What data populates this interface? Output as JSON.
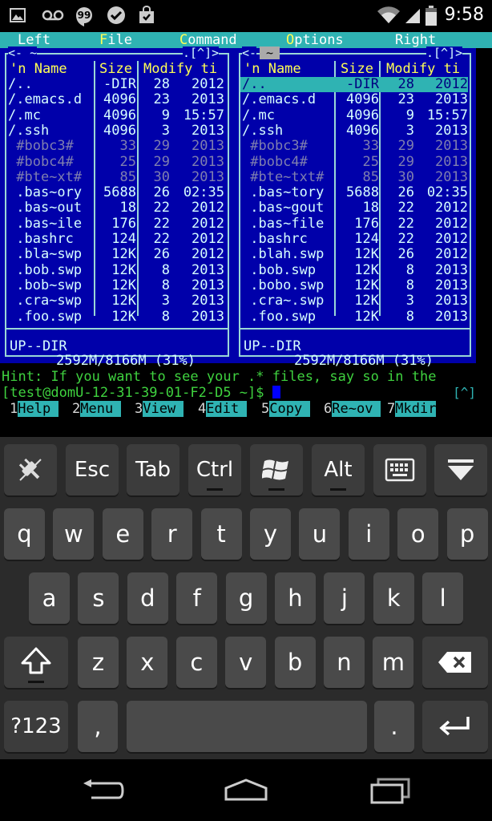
{
  "status_bar": {
    "time": "9:58"
  },
  "terminal": {
    "menu": [
      {
        "hot": "",
        "label": "Left"
      },
      {
        "hot": "F",
        "label": "ile"
      },
      {
        "hot": "C",
        "label": "ommand"
      },
      {
        "hot": "O",
        "label": "ptions"
      },
      {
        "hot": "",
        "label": "Right"
      }
    ],
    "left_panel": {
      "top_left": "<- ~",
      "top_right": ".[^]>",
      "header_name": "'n Name",
      "header_size": "Size",
      "header_modify": "Modify ti",
      "rows": [
        {
          "name": "/..",
          "size": "-DIR",
          "d": "28",
          "t": "2012",
          "dim": false
        },
        {
          "name": "/.emacs.d",
          "size": "4096",
          "d": "23",
          "t": "2013",
          "dim": false
        },
        {
          "name": "/.mc",
          "size": "4096",
          "d": "9",
          "t": "15:57",
          "dim": false
        },
        {
          "name": "/.ssh",
          "size": "4096",
          "d": "3",
          "t": "2013",
          "dim": false
        },
        {
          "name": " #bobc3#",
          "size": "33",
          "d": "29",
          "t": "2013",
          "dim": true
        },
        {
          "name": " #bobc4#",
          "size": "25",
          "d": "29",
          "t": "2013",
          "dim": true
        },
        {
          "name": " #bte~xt#",
          "size": "85",
          "d": "30",
          "t": "2013",
          "dim": true
        },
        {
          "name": " .bas~ory",
          "size": "5688",
          "d": "26",
          "t": "02:35",
          "dim": false
        },
        {
          "name": " .bas~out",
          "size": "18",
          "d": "22",
          "t": "2012",
          "dim": false
        },
        {
          "name": " .bas~ile",
          "size": "176",
          "d": "22",
          "t": "2012",
          "dim": false
        },
        {
          "name": " .bashrc",
          "size": "124",
          "d": "22",
          "t": "2012",
          "dim": false
        },
        {
          "name": " .bla~swp",
          "size": "12K",
          "d": "26",
          "t": "2012",
          "dim": false
        },
        {
          "name": " .bob.swp",
          "size": "12K",
          "d": "8",
          "t": "2013",
          "dim": false
        },
        {
          "name": " .bob~swp",
          "size": "12K",
          "d": "8",
          "t": "2013",
          "dim": false
        },
        {
          "name": " .cra~swp",
          "size": "12K",
          "d": "3",
          "t": "2013",
          "dim": false
        },
        {
          "name": " .foo.swp",
          "size": "12K",
          "d": "8",
          "t": "2013",
          "dim": false
        }
      ],
      "status": "UP--DIR",
      "disk": "2592M/8166M (31%)"
    },
    "right_panel": {
      "top_left": "<-",
      "top_active": "~",
      "top_right": ".[^]>",
      "header_name": "'n Name",
      "header_size": "Size",
      "header_modify": "Modify ti",
      "rows": [
        {
          "name": "/..",
          "size": "-DIR",
          "d": "28",
          "t": "2012",
          "dim": false
        },
        {
          "name": "/.emacs.d",
          "size": "4096",
          "d": "23",
          "t": "2013",
          "dim": false
        },
        {
          "name": "/.mc",
          "size": "4096",
          "d": "9",
          "t": "15:57",
          "dim": false
        },
        {
          "name": "/.ssh",
          "size": "4096",
          "d": "3",
          "t": "2013",
          "dim": false
        },
        {
          "name": " #bobc3#",
          "size": "33",
          "d": "29",
          "t": "2013",
          "dim": true
        },
        {
          "name": " #bobc4#",
          "size": "25",
          "d": "29",
          "t": "2013",
          "dim": true
        },
        {
          "name": " #bte~txt#",
          "size": "85",
          "d": "30",
          "t": "2013",
          "dim": true
        },
        {
          "name": " .bas~tory",
          "size": "5688",
          "d": "26",
          "t": "02:35",
          "dim": false
        },
        {
          "name": " .bas~gout",
          "size": "18",
          "d": "22",
          "t": "2012",
          "dim": false
        },
        {
          "name": " .bas~file",
          "size": "176",
          "d": "22",
          "t": "2012",
          "dim": false
        },
        {
          "name": " .bashrc",
          "size": "124",
          "d": "22",
          "t": "2012",
          "dim": false
        },
        {
          "name": " .blah.swp",
          "size": "12K",
          "d": "26",
          "t": "2012",
          "dim": false
        },
        {
          "name": " .bob.swp",
          "size": "12K",
          "d": "8",
          "t": "2013",
          "dim": false
        },
        {
          "name": " .bobo.swp",
          "size": "12K",
          "d": "8",
          "t": "2013",
          "dim": false
        },
        {
          "name": " .cra~.swp",
          "size": "12K",
          "d": "3",
          "t": "2013",
          "dim": false
        },
        {
          "name": " .foo.swp",
          "size": "12K",
          "d": "8",
          "t": "2013",
          "dim": false
        }
      ],
      "status": "UP--DIR",
      "disk": "2592M/8166M (31%)"
    },
    "hint": "Hint: If you want to see your .* files, say so in the",
    "prompt": "[test@domU-12-31-39-01-F2-D5 ~]$ ",
    "prompt_right": "[^]",
    "fkeys": [
      {
        "num": "1",
        "label": "Help"
      },
      {
        "num": "2",
        "label": "Menu"
      },
      {
        "num": "3",
        "label": "View"
      },
      {
        "num": "4",
        "label": "Edit"
      },
      {
        "num": "5",
        "label": "Copy"
      },
      {
        "num": "6",
        "label": "Re~ov"
      },
      {
        "num": "7",
        "label": "Mkdir"
      }
    ]
  },
  "keyboard": {
    "row_fn": [
      "Esc",
      "Tab",
      "Ctrl",
      "Alt"
    ],
    "row1": [
      "q",
      "w",
      "e",
      "r",
      "t",
      "y",
      "u",
      "i",
      "o",
      "p"
    ],
    "row2": [
      "a",
      "s",
      "d",
      "f",
      "g",
      "h",
      "j",
      "k",
      "l"
    ],
    "row3": [
      "z",
      "x",
      "c",
      "v",
      "b",
      "n",
      "m"
    ],
    "symbols": "?123",
    "comma": ",",
    "period": "."
  }
}
